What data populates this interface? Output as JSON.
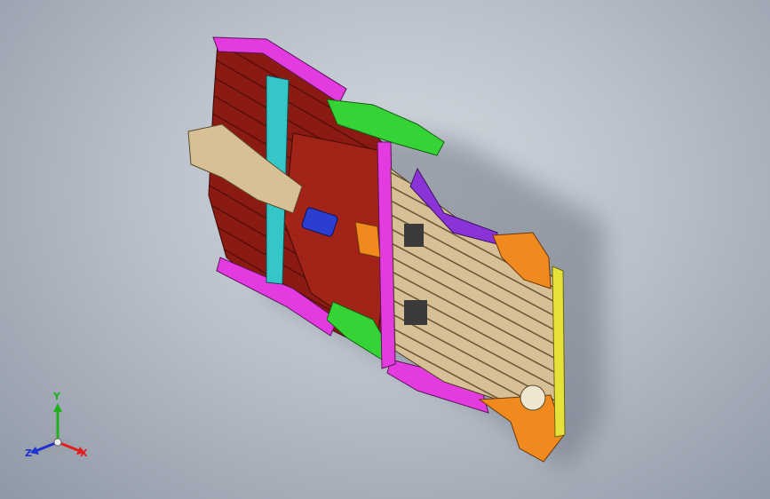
{
  "viewport": {
    "background_top": "#d6dbe2",
    "background_bottom": "#8f98a6"
  },
  "model": {
    "colors": {
      "dark_red": "#8b1a12",
      "red_mid": "#a52418",
      "magenta": "#e43be0",
      "green": "#35d335",
      "cyan": "#35c6c8",
      "tan": "#d8c096",
      "orange": "#f08a1e",
      "blue": "#2a3fd0",
      "purple": "#8a34d8",
      "yellow": "#e6e23a"
    }
  },
  "triad": {
    "x_label": "X",
    "y_label": "Y",
    "z_label": "Z",
    "x_color": "#e02020",
    "y_color": "#20b020",
    "z_color": "#2030d0"
  }
}
